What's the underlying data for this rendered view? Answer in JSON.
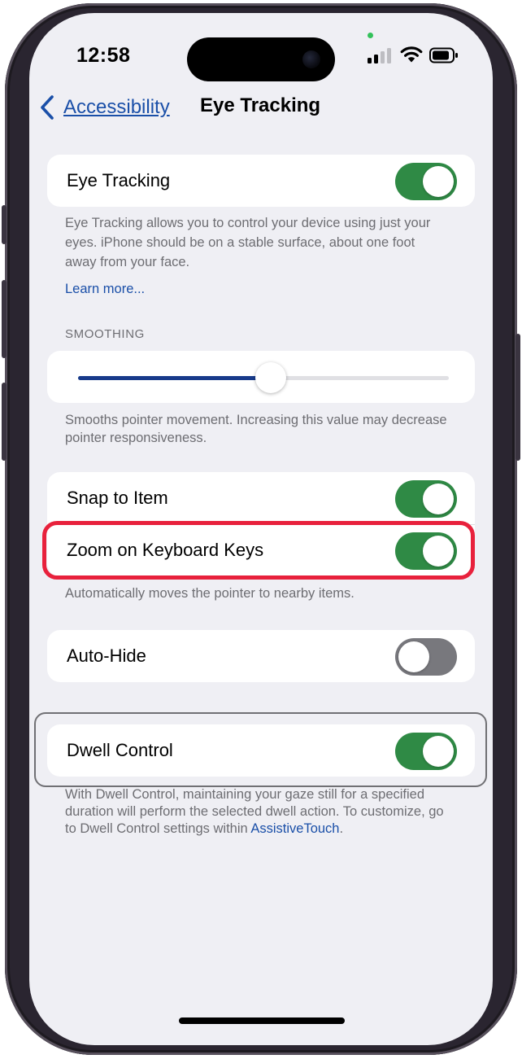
{
  "status_bar": {
    "time": "12:58"
  },
  "nav": {
    "back_label": "Accessibility",
    "title": "Eye Tracking"
  },
  "eye_tracking": {
    "label": "Eye Tracking",
    "enabled": true,
    "description": "Eye Tracking allows you to control your device using just your eyes. iPhone should be on a stable surface, about one foot away from your face.",
    "learn_more": "Learn more..."
  },
  "smoothing": {
    "header": "SMOOTHING",
    "value_fraction": 0.52,
    "footer": "Smooths pointer movement. Increasing this value may decrease pointer responsiveness."
  },
  "snap_group": {
    "snap_to_item": {
      "label": "Snap to Item",
      "enabled": true
    },
    "zoom_on_keyboard_keys": {
      "label": "Zoom on Keyboard Keys",
      "enabled": true
    },
    "footer": "Automatically moves the pointer to nearby items."
  },
  "auto_hide": {
    "label": "Auto-Hide",
    "enabled": false
  },
  "dwell_control": {
    "label": "Dwell Control",
    "enabled": true,
    "footer_text": "With Dwell Control, maintaining your gaze still for a specified duration will perform the selected dwell action. To customize, go to Dwell Control settings within ",
    "footer_link": "AssistiveTouch",
    "footer_end": "."
  },
  "colors": {
    "toggle_on": "#2f8a45",
    "toggle_off": "#78787d",
    "link": "#1a4fa8",
    "highlight_red": "#e8213c",
    "slider_fill": "#173a8a"
  },
  "icons": [
    "chevron-left-icon",
    "signal-icon",
    "wifi-icon",
    "battery-icon"
  ]
}
